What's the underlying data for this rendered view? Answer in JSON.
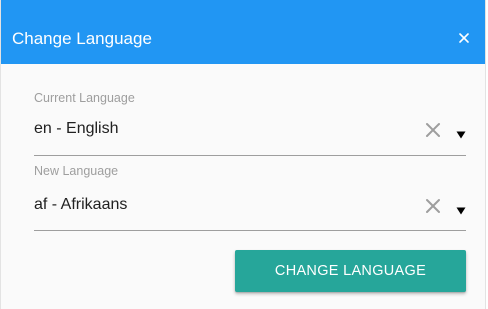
{
  "dialog": {
    "title": "Change Language",
    "close_icon": "close-icon",
    "colors": {
      "header": "#2196f3",
      "button": "#26a69a"
    }
  },
  "current_language": {
    "label": "Current Language",
    "value": "en - English",
    "clear_icon": "clear-icon",
    "dropdown_icon": "dropdown-arrow-icon"
  },
  "new_language": {
    "label": "New Language",
    "value": "af - Afrikaans",
    "clear_icon": "clear-icon",
    "dropdown_icon": "dropdown-arrow-icon"
  },
  "actions": {
    "change_label": "CHANGE LANGUAGE"
  }
}
